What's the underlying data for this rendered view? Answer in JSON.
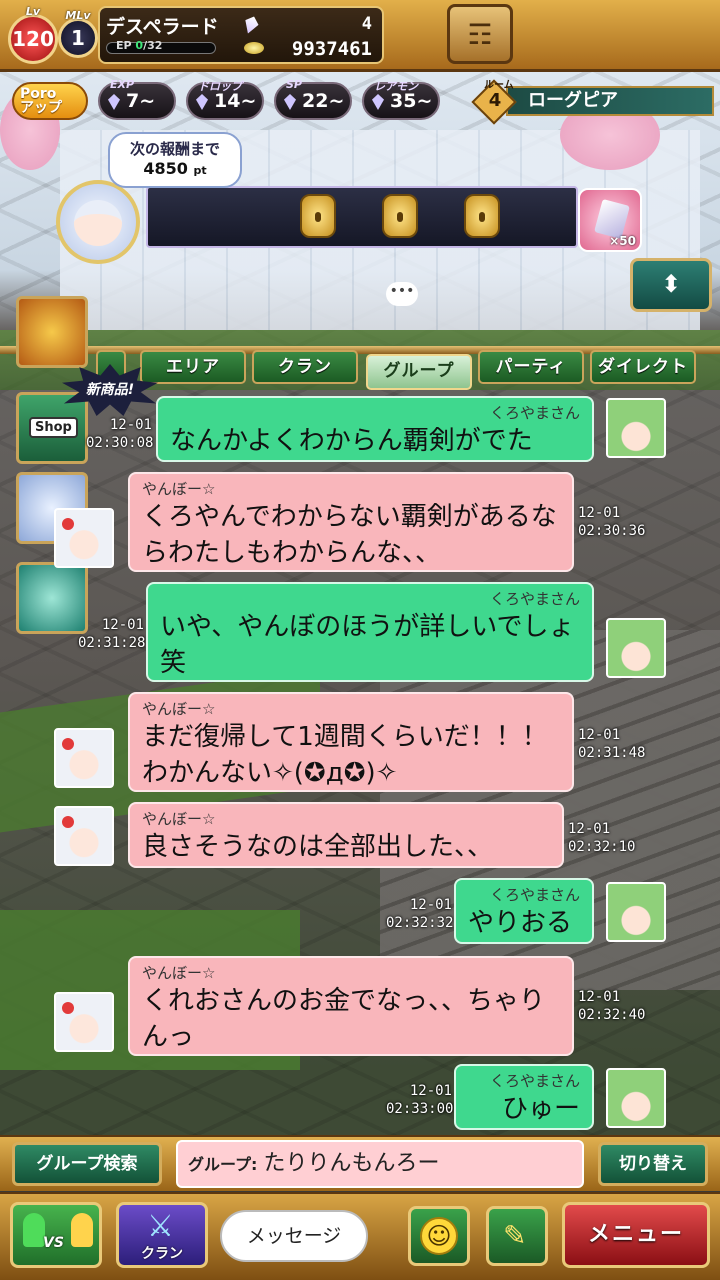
{
  "status": {
    "lv_caption": "Lv",
    "level": "120",
    "mlv_caption": "MLv",
    "master_level": "1",
    "player_name": "デスペラード",
    "ep_label": "EP",
    "ep_current": "0",
    "ep_max": "/32",
    "ep_progress": 0,
    "gems": "4",
    "gold": "9937461"
  },
  "boosts": {
    "poro_label": "Poro",
    "poro_sub": "アップ",
    "exp_label": "EXP",
    "exp_value": "7~",
    "drop_label": "ドロップ",
    "drop_value": "14~",
    "sp_label": "SP",
    "sp_value": "22~",
    "rare_label": "レアモン",
    "rare_value": "35~"
  },
  "room": {
    "caption": "ルーム",
    "number": "4",
    "name": "ローグピア"
  },
  "reward": {
    "label": "次の報酬まで",
    "points": "4850",
    "unit": "pt",
    "item_count": "×50"
  },
  "side": {
    "new_badge": "新商品!",
    "shop_label": "Shop"
  },
  "tabs": [
    {
      "label": "エリア"
    },
    {
      "label": "クラン"
    },
    {
      "label": "グループ"
    },
    {
      "label": "パーティ"
    },
    {
      "label": "ダイレクト"
    }
  ],
  "messages": [
    {
      "sender": "くろやまさん",
      "text": "なんかよくわからん覇剣がでた",
      "date": "12-01",
      "time": "02:30:08"
    },
    {
      "sender": "やんぼー☆",
      "text": "くろやんでわからない覇剣があるならわたしもわからんな、、",
      "date": "12-01",
      "time": "02:30:36"
    },
    {
      "sender": "くろやまさん",
      "text": "いや、やんぼのほうが詳しいでしょ笑",
      "date": "12-01",
      "time": "02:31:28"
    },
    {
      "sender": "やんぼー☆",
      "text": "まだ復帰して1週間くらいだ！！！わかんない✧(✪д✪)✧",
      "date": "12-01",
      "time": "02:31:48"
    },
    {
      "sender": "やんぼー☆",
      "text": "良さそうなのは全部出した、、",
      "date": "12-01",
      "time": "02:32:10"
    },
    {
      "sender": "くろやまさん",
      "text": "やりおる",
      "date": "12-01",
      "time": "02:32:32"
    },
    {
      "sender": "やんぼー☆",
      "text": "くれおさんのお金でなっ、、ちゃりんっ",
      "date": "12-01",
      "time": "02:32:40"
    },
    {
      "sender": "くろやまさん",
      "text": "ひゅー",
      "date": "12-01",
      "time": "02:33:00"
    }
  ],
  "input": {
    "group_search": "グループ検索",
    "group_label": "グループ:",
    "group_name": "たりりんもんろー",
    "switch": "切り替え"
  },
  "bottom": {
    "vs_label": "VS",
    "clan_label": "クラン",
    "message_placeholder": "メッセージ",
    "menu_label": "メニュー"
  },
  "colors": {
    "mine_bubble": "#3fd88e",
    "their_bubble": "#f9b6bb",
    "frame_gold": "#c9a45a"
  }
}
